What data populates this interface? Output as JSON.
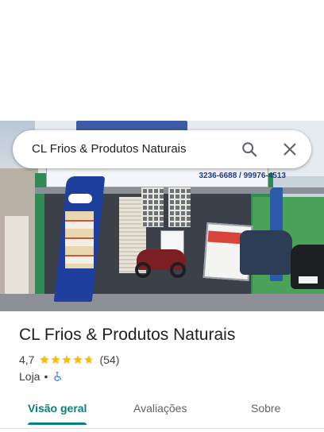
{
  "search": {
    "query": "CL Frios & Produtos Naturais",
    "search_icon": "search-icon",
    "close_icon": "close-icon"
  },
  "photo": {
    "description_icon": "storefront-photo",
    "banner_text": "3236-6688 / 99976-4513"
  },
  "place": {
    "name": "CL Frios & Produtos Naturais",
    "rating": "4,7",
    "rating_value": 4.7,
    "reviews": "(54)",
    "category": "Loja",
    "separator": "•",
    "accessibility_icon": "wheelchair-icon"
  },
  "tabs": [
    {
      "label": "Visão geral",
      "active": true
    },
    {
      "label": "Avaliações",
      "active": false
    },
    {
      "label": "Sobre",
      "active": false
    }
  ],
  "colors": {
    "accent": "#0b7f78",
    "star": "#fbbc04",
    "accessibility": "#1a73e8"
  }
}
